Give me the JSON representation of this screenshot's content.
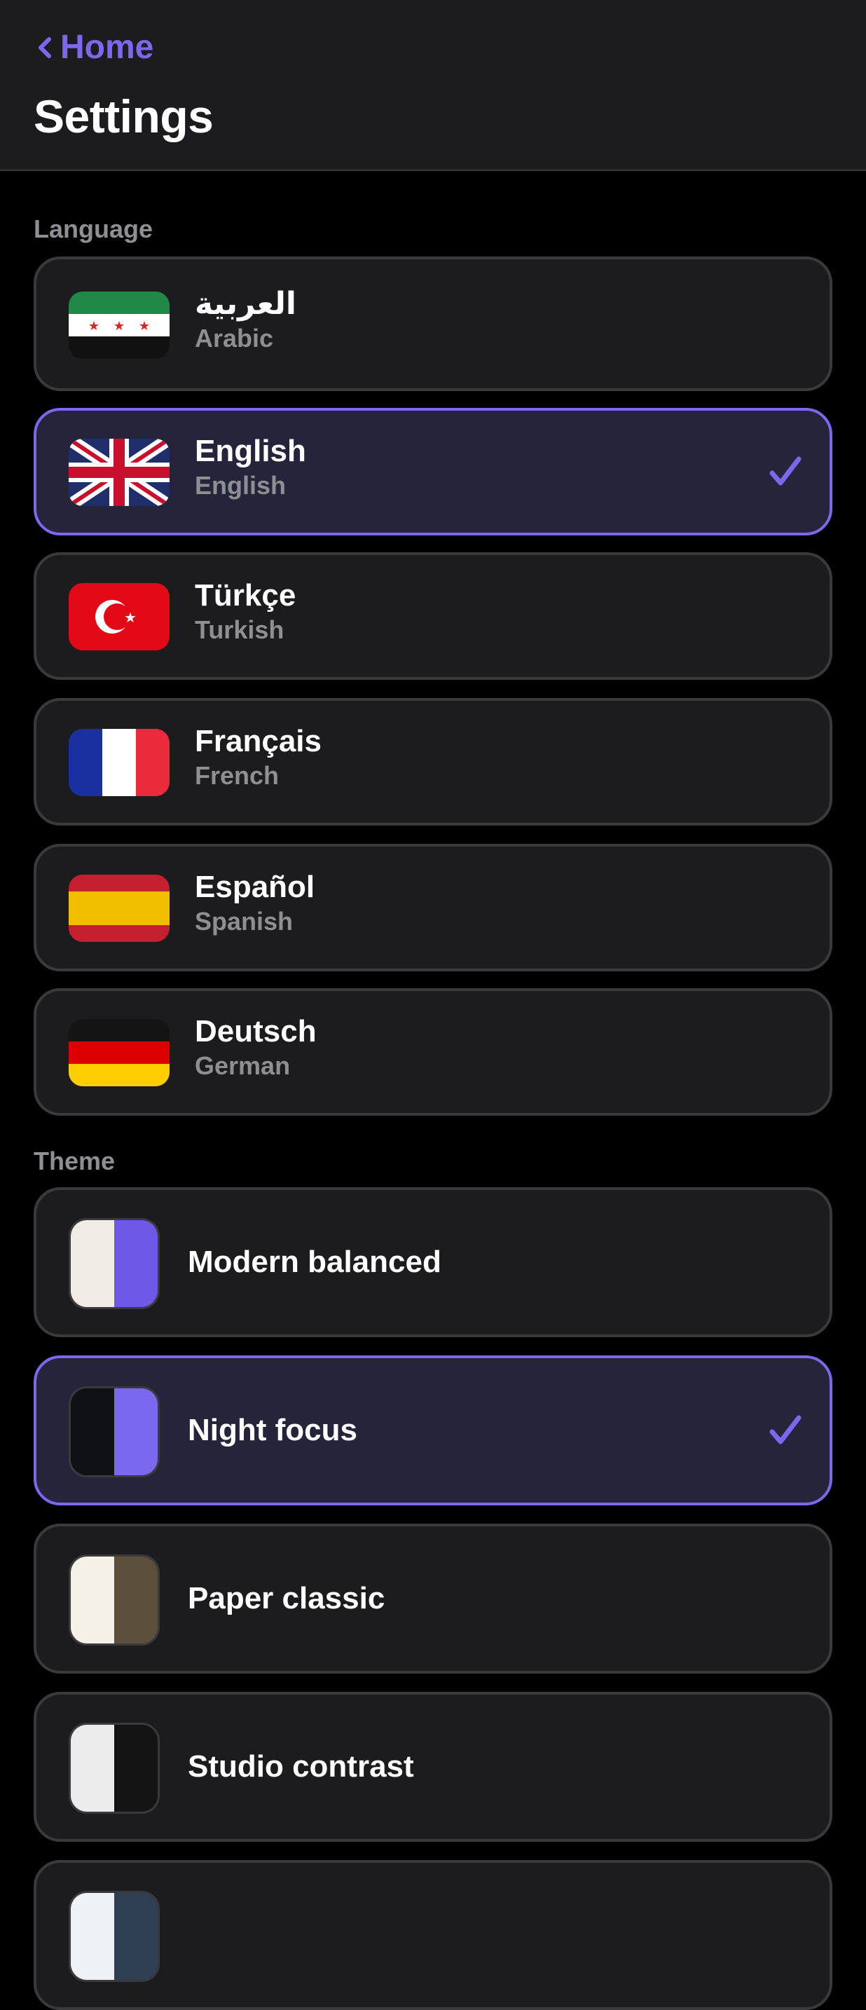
{
  "header": {
    "back_label": "Home",
    "title": "Settings"
  },
  "language_section": {
    "label": "Language",
    "items": [
      {
        "native": "العربية",
        "english": "Arabic",
        "flag": "syria-flag-icon",
        "selected": false
      },
      {
        "native": "English",
        "english": "English",
        "flag": "uk-flag-icon",
        "selected": true
      },
      {
        "native": "Türkçe",
        "english": "Turkish",
        "flag": "turkey-flag-icon",
        "selected": false
      },
      {
        "native": "Français",
        "english": "French",
        "flag": "france-flag-icon",
        "selected": false
      },
      {
        "native": "Español",
        "english": "Spanish",
        "flag": "spain-flag-icon",
        "selected": false
      },
      {
        "native": "Deutsch",
        "english": "German",
        "flag": "germany-flag-icon",
        "selected": false
      }
    ]
  },
  "theme_section": {
    "label": "Theme",
    "items": [
      {
        "label": "Modern balanced",
        "colors": [
          "#f1ede6",
          "#6e58e8"
        ],
        "selected": false
      },
      {
        "label": "Night focus",
        "colors": [
          "#0f1115",
          "#7a68f0"
        ],
        "selected": true
      },
      {
        "label": "Paper classic",
        "colors": [
          "#f5f1e8",
          "#5d503b"
        ],
        "selected": false
      },
      {
        "label": "Studio contrast",
        "colors": [
          "#ececec",
          "#141414"
        ],
        "selected": false
      },
      {
        "label": "",
        "colors": [
          "#eef2f7",
          "#2f4054"
        ],
        "selected": false
      }
    ]
  },
  "colors": {
    "accent": "#7b68ee",
    "background": "#000000",
    "card": "#1c1c1e",
    "card_selected": "#25243a",
    "secondary_text": "#8e8e93"
  },
  "icons": {
    "back": "chevron-left-icon",
    "selected": "checkmark-icon"
  }
}
